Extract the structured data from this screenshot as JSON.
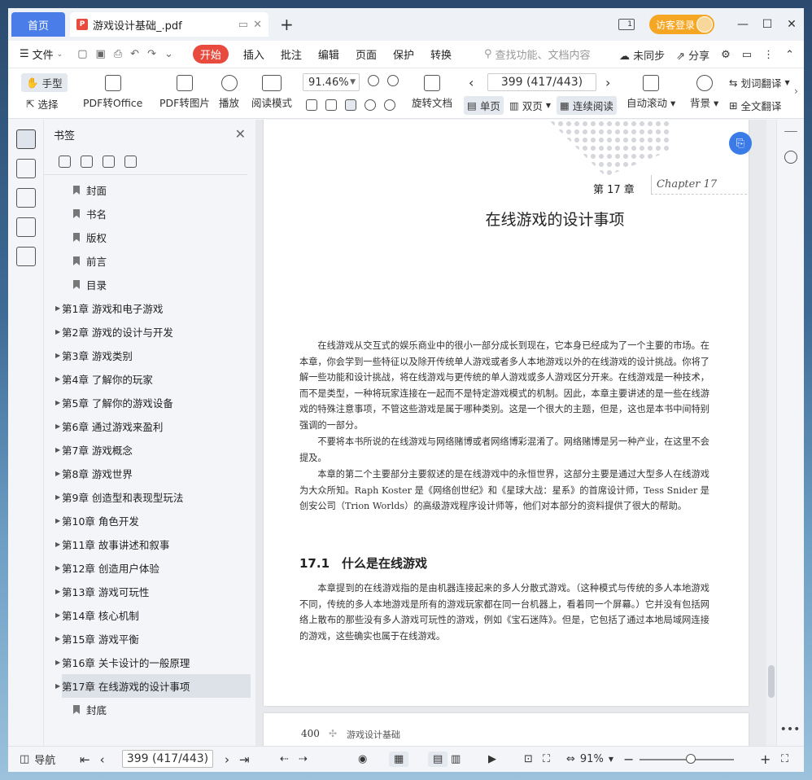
{
  "titlebar": {
    "home_tab": "首页",
    "doc_tab": "游戏设计基础_.pdf",
    "new_tab": "+",
    "login": "访客登录"
  },
  "menubar": {
    "file": "文件",
    "start": "开始",
    "items": [
      "插入",
      "批注",
      "编辑",
      "页面",
      "保护",
      "转换"
    ],
    "search_placeholder": "查找功能、文档内容",
    "unsync": "未同步",
    "share": "分享"
  },
  "toolbar": {
    "hand": "手型",
    "select": "选择",
    "pdf_to_office": "PDF转Office",
    "pdf_to_image": "PDF转图片",
    "play": "播放",
    "read_mode": "阅读模式",
    "zoom": "91.46%",
    "rotate": "旋转文档",
    "page_indicator": "399 (417/443)",
    "single": "单页",
    "double": "双页",
    "continuous": "连续阅读",
    "auto_scroll": "自动滚动",
    "background": "背景",
    "word_translate": "划词翻译",
    "full_translate": "全文翻译"
  },
  "bookmarks": {
    "title": "书签",
    "items": [
      {
        "label": "封面",
        "expandable": false
      },
      {
        "label": "书名",
        "expandable": false
      },
      {
        "label": "版权",
        "expandable": false
      },
      {
        "label": "前言",
        "expandable": false
      },
      {
        "label": "目录",
        "expandable": false
      },
      {
        "label": "第1章 游戏和电子游戏",
        "expandable": true
      },
      {
        "label": "第2章 游戏的设计与开发",
        "expandable": true
      },
      {
        "label": "第3章 游戏类别",
        "expandable": true
      },
      {
        "label": "第4章 了解你的玩家",
        "expandable": true
      },
      {
        "label": "第5章 了解你的游戏设备",
        "expandable": true
      },
      {
        "label": "第6章 通过游戏来盈利",
        "expandable": true
      },
      {
        "label": "第7章 游戏概念",
        "expandable": true
      },
      {
        "label": "第8章 游戏世界",
        "expandable": true
      },
      {
        "label": "第9章 创造型和表现型玩法",
        "expandable": true
      },
      {
        "label": "第10章 角色开发",
        "expandable": true
      },
      {
        "label": "第11章 故事讲述和叙事",
        "expandable": true
      },
      {
        "label": "第12章 创造用户体验",
        "expandable": true
      },
      {
        "label": "第13章 游戏可玩性",
        "expandable": true
      },
      {
        "label": "第14章 核心机制",
        "expandable": true
      },
      {
        "label": "第15章 游戏平衡",
        "expandable": true
      },
      {
        "label": "第16章 关卡设计的一般原理",
        "expandable": true
      },
      {
        "label": "第17章 在线游戏的设计事项",
        "expandable": true,
        "selected": true
      },
      {
        "label": "封底",
        "expandable": false
      }
    ]
  },
  "page": {
    "chapter_label": "第 17 章",
    "chapter_script": "Chapter 17",
    "chapter_title": "在线游戏的设计事项",
    "para1": "在线游戏从交互式的娱乐商业中的很小一部分成长到现在，它本身已经成为了一个主要的市场。在本章，你会学到一些特征以及除开传统单人游戏或者多人本地游戏以外的在线游戏的设计挑战。你将了解一些功能和设计挑战，将在线游戏与更传统的单人游戏或多人游戏区分开来。在线游戏是一种技术，而不是类型，一种将玩家连接在一起而不是特定游戏模式的机制。因此，本章主要讲述的是一些在线游戏的特殊注意事项，不管这些游戏是属于哪种类别。这是一个很大的主题，但是，这也是本书中间特别强调的一部分。",
    "para2": "不要将本书所说的在线游戏与网络赌博或者网络博彩混淆了。网络赌博是另一种产业，在这里不会提及。",
    "para3": "本章的第二个主要部分主要叙述的是在线游戏中的永恒世界，这部分主要是通过大型多人在线游戏为大众所知。Raph Koster 是《网络创世纪》和《星球大战：星系》的首席设计师，Tess Snider 是创安公司（Trion Worlds）的高级游戏程序设计师等，他们对本部分的资料提供了很大的帮助。",
    "section_title": "17.1　什么是在线游戏",
    "para4": "本章提到的在线游戏指的是由机器连接起来的多人分散式游戏。（这种模式与传统的多人本地游戏不同，传统的多人本地游戏是所有的游戏玩家都在同一台机器上，看着同一个屏幕。）它并没有包括网络上散布的那些没有多人游戏可玩性的游戏，例如《宝石迷阵》。但是，它包括了通过本地局域网连接的游戏，这些确实也属于在线游戏。",
    "footer_page": "400",
    "footer_title": "游戏设计基础"
  },
  "statusbar": {
    "nav": "导航",
    "page_indicator": "399 (417/443)",
    "zoom": "91%"
  }
}
